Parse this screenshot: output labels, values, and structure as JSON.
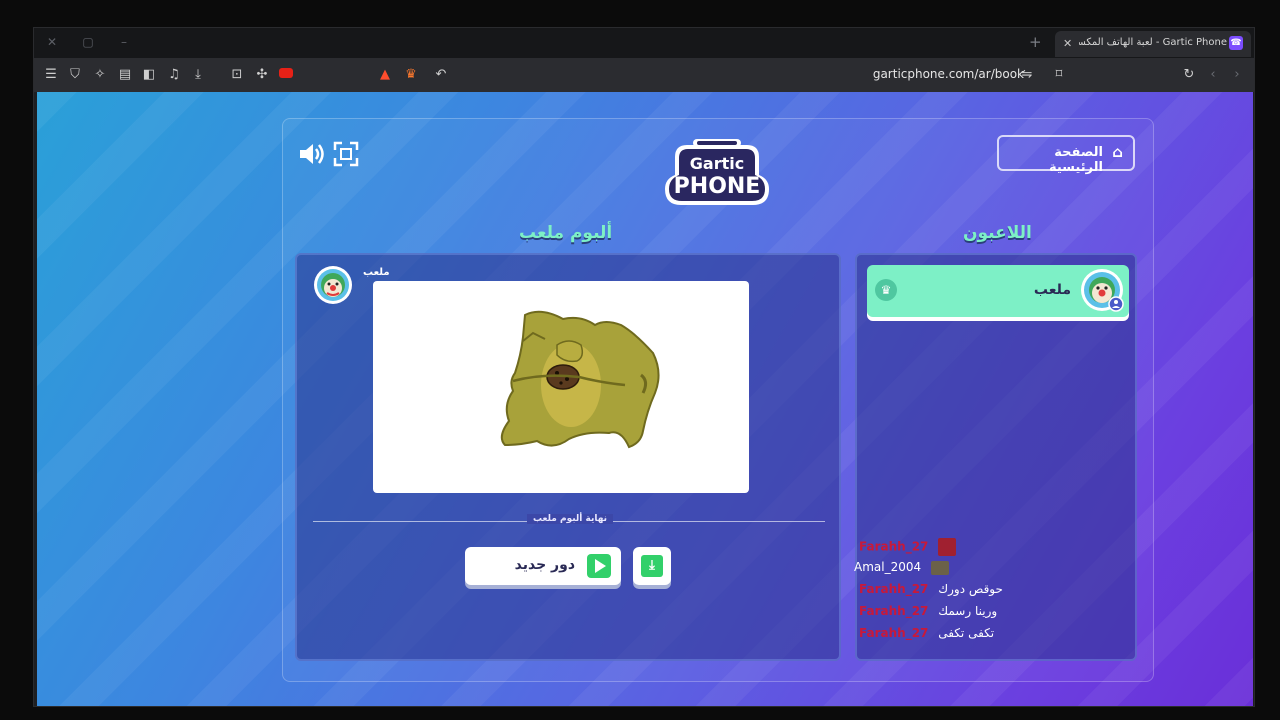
{
  "browser": {
    "tab_title": "Gartic Phone - لعبة الهاتف المكسور",
    "url": "garticphone.com/ar/book"
  },
  "game": {
    "home_button": "الصفحة الرئيسية",
    "players_header": "اللاعبون",
    "album_header": "ألبوم ملعب",
    "player_name": "ملعب",
    "album_author": "ملعب",
    "end_of_album": "نهاية ألبوم ملعب",
    "new_round_button": "دور جديد"
  },
  "chat": [
    {
      "user": "Farahh_27",
      "text": ""
    },
    {
      "user": "Amal_2004",
      "text": ""
    },
    {
      "user": "Farahh_27",
      "text": "حوقص دورك"
    },
    {
      "user": "Farahh_27",
      "text": "ورينا رسمك"
    },
    {
      "user": "Farahh_27",
      "text": "تكفى تكفى"
    }
  ],
  "colors": {
    "accent_green": "#7df0c6",
    "play_green": "#32d06a",
    "chat_user_red": "#c8193a"
  }
}
